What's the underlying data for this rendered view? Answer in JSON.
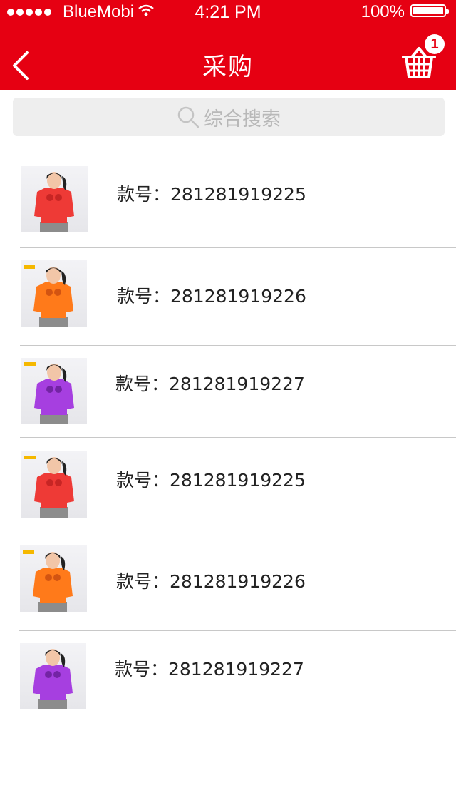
{
  "status_bar": {
    "carrier": "BlueMobi",
    "time": "4:21 PM",
    "battery": "100%"
  },
  "nav": {
    "title": "采购",
    "cart_count": "1",
    "back_icon": "chevron-left-icon",
    "cart_icon": "shopping-basket-icon"
  },
  "search": {
    "placeholder": "综合搜索"
  },
  "colors": {
    "brand": "#e60012"
  },
  "products": [
    {
      "code": "款号：281281919225",
      "shirt_color": "#ee3a36"
    },
    {
      "code": "款号：281281919226",
      "shirt_color": "#ff7a1a"
    },
    {
      "code": "款号：281281919227",
      "shirt_color": "#a63fe0"
    },
    {
      "code": "款号：281281919225",
      "shirt_color": "#ee3a36"
    },
    {
      "code": "款号：281281919226",
      "shirt_color": "#ff7a1a"
    },
    {
      "code": "款号：281281919227",
      "shirt_color": "#a63fe0"
    }
  ]
}
